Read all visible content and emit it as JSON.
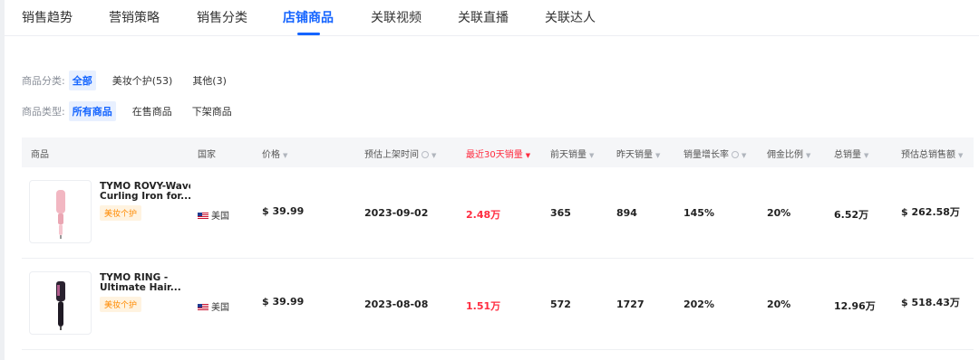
{
  "tabs": [
    {
      "label": "销售趋势"
    },
    {
      "label": "营销策略"
    },
    {
      "label": "销售分类"
    },
    {
      "label": "店铺商品",
      "active": true
    },
    {
      "label": "关联视频"
    },
    {
      "label": "关联直播"
    },
    {
      "label": "关联达人"
    }
  ],
  "filters": {
    "category": {
      "label": "商品分类:",
      "options": [
        "全部",
        "美妆个护(53)",
        "其他(3)"
      ],
      "selected": "全部"
    },
    "type": {
      "label": "商品类型:",
      "options": [
        "所有商品",
        "在售商品",
        "下架商品"
      ],
      "selected": "所有商品"
    }
  },
  "table": {
    "headers": {
      "product": "商品",
      "country": "国家",
      "price": "价格",
      "launch": "预估上架时间",
      "sales30": "最近30天销量",
      "day_before": "前天销量",
      "yesterday": "昨天销量",
      "growth": "销量增长率",
      "commission": "佣金比例",
      "total": "总销量",
      "gmv": "预估总销售额"
    },
    "sort_glyph": "▼",
    "rows": [
      {
        "name_line1": "TYMO ROVY-Wave",
        "name_line2": "Curling Iron for...",
        "tag": "美妆个护",
        "country": "美国",
        "price": "$ 39.99",
        "launch": "2023-09-02",
        "sales30": "2.48万",
        "day_before": "365",
        "yesterday": "894",
        "growth": "145%",
        "commission": "20%",
        "total": "6.52万",
        "gmv": "$ 262.58万",
        "thumb_icon": "curling-iron-icon"
      },
      {
        "name_line1": "TYMO RING -",
        "name_line2": "Ultimate Hair...",
        "tag": "美妆个护",
        "country": "美国",
        "price": "$ 39.99",
        "launch": "2023-08-08",
        "sales30": "1.51万",
        "day_before": "572",
        "yesterday": "1727",
        "growth": "202%",
        "commission": "20%",
        "total": "12.96万",
        "gmv": "$ 518.43万",
        "thumb_icon": "hair-straightener-brush-icon"
      }
    ]
  },
  "colors": {
    "accent": "#1464ff",
    "highlight_red": "#ff2b3f",
    "tag_orange": "#ff8a00",
    "header_bg": "#f5f6f8"
  }
}
